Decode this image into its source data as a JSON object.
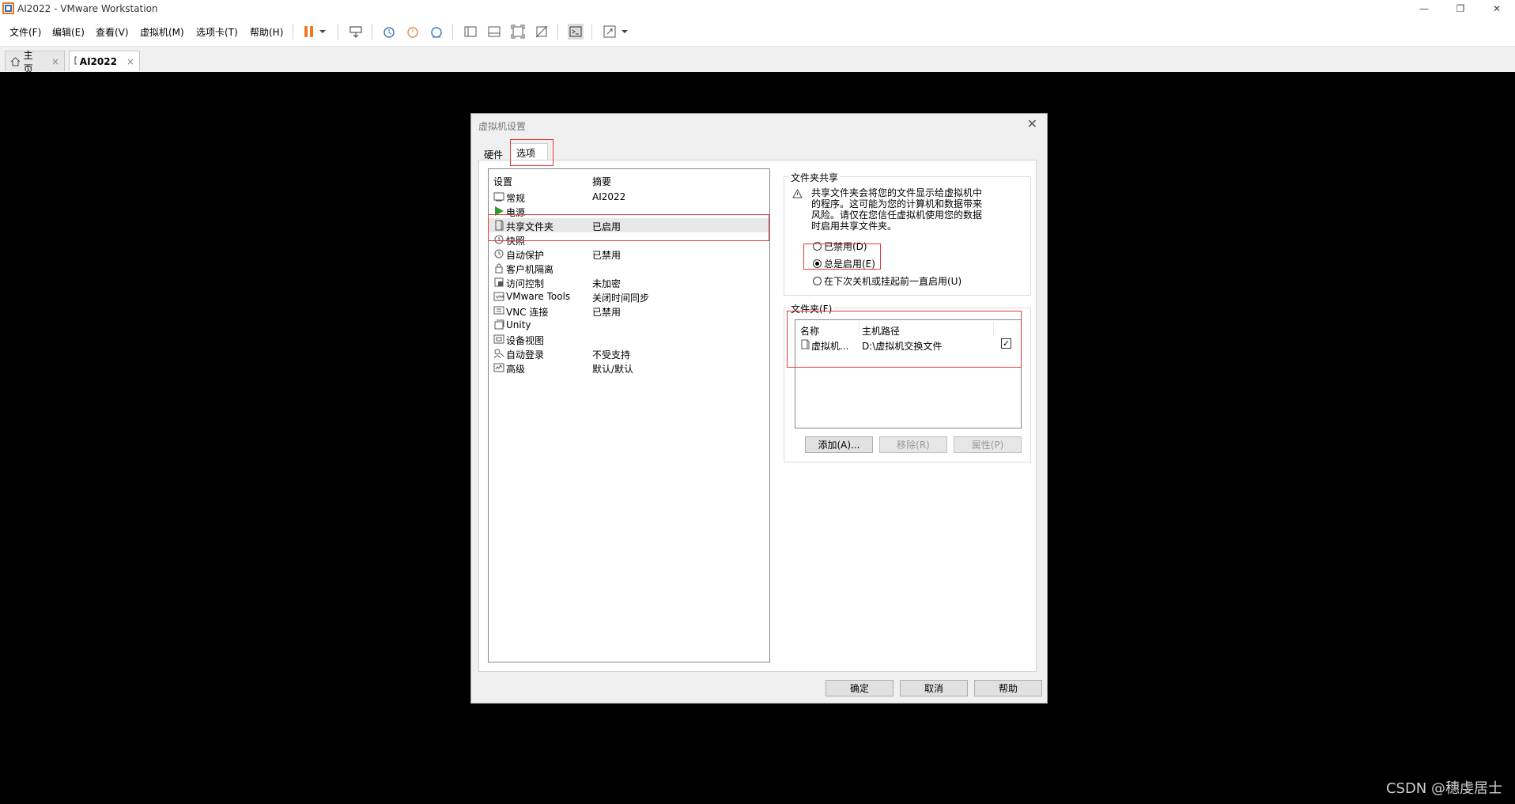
{
  "window": {
    "title": "AI2022 - VMware Workstation"
  },
  "menu": [
    "文件(F)",
    "编辑(E)",
    "查看(V)",
    "虚拟机(M)",
    "选项卡(T)",
    "帮助(H)"
  ],
  "tabs": [
    {
      "label": "主页",
      "active": false
    },
    {
      "label": "AI2022",
      "active": true
    }
  ],
  "dialog": {
    "title": "虚拟机设置",
    "tabs": [
      "硬件",
      "选项"
    ],
    "active_tab": "选项",
    "list_headers": {
      "setting": "设置",
      "summary": "摘要"
    },
    "settings": [
      {
        "name": "常规",
        "summary": "AI2022",
        "icon": "general-icon"
      },
      {
        "name": "电源",
        "summary": "",
        "icon": "power-icon"
      },
      {
        "name": "共享文件夹",
        "summary": "已启用",
        "icon": "shared-folder-icon",
        "selected": true
      },
      {
        "name": "快照",
        "summary": "",
        "icon": "snapshot-icon"
      },
      {
        "name": "自动保护",
        "summary": "已禁用",
        "icon": "autoprotect-icon"
      },
      {
        "name": "客户机隔离",
        "summary": "",
        "icon": "lock-icon"
      },
      {
        "name": "访问控制",
        "summary": "未加密",
        "icon": "access-control-icon"
      },
      {
        "name": "VMware Tools",
        "summary": "关闭时间同步",
        "icon": "vmware-tools-icon"
      },
      {
        "name": "VNC 连接",
        "summary": "已禁用",
        "icon": "vnc-icon"
      },
      {
        "name": "Unity",
        "summary": "",
        "icon": "unity-icon"
      },
      {
        "name": "设备视图",
        "summary": "",
        "icon": "device-view-icon"
      },
      {
        "name": "自动登录",
        "summary": "不受支持",
        "icon": "autologin-icon"
      },
      {
        "name": "高级",
        "summary": "默认/默认",
        "icon": "advanced-icon"
      }
    ],
    "folder_sharing": {
      "legend": "文件夹共享",
      "warning_lines": [
        "共享文件夹会将您的文件显示给虚拟机中",
        "的程序。这可能为您的计算机和数据带来",
        "风险。请仅在您信任虚拟机使用您的数据",
        "时启用共享文件夹。"
      ],
      "options": [
        {
          "label": "已禁用(D)",
          "checked": false
        },
        {
          "label": "总是启用(E)",
          "checked": true
        },
        {
          "label": "在下次关机或挂起前一直启用(U)",
          "checked": false
        }
      ]
    },
    "folders": {
      "legend": "文件夹(F)",
      "headers": {
        "name": "名称",
        "path": "主机路径"
      },
      "rows": [
        {
          "name": "虚拟机...",
          "path": "D:\\虚拟机交换文件",
          "enabled": true
        }
      ],
      "buttons": {
        "add": "添加(A)...",
        "remove": "移除(R)",
        "properties": "属性(P)"
      }
    },
    "footer": {
      "ok": "确定",
      "cancel": "取消",
      "help": "帮助"
    }
  },
  "watermark": "CSDN @穗虔居士"
}
